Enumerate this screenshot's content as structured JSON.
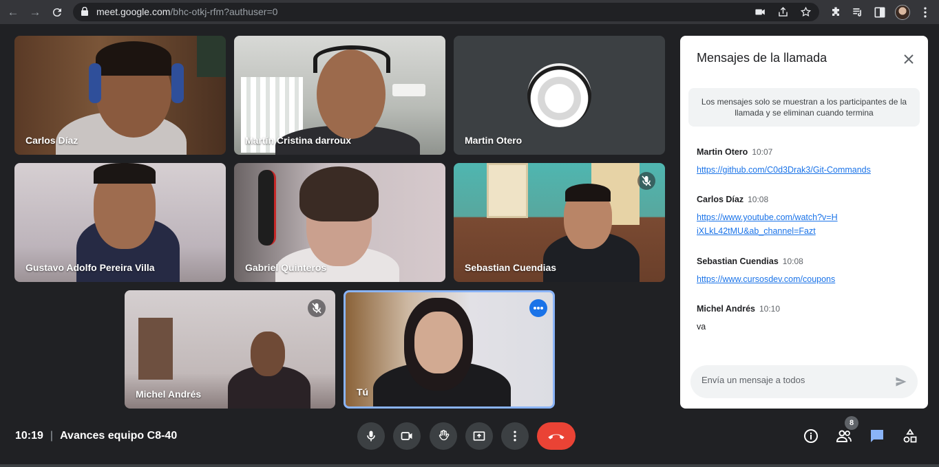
{
  "browser": {
    "url_host": "meet.google.com",
    "url_path": "/bhc-otkj-rfm?authuser=0"
  },
  "tiles": [
    {
      "name": "Carlos Díaz"
    },
    {
      "name": "Martín Cristina darroux"
    },
    {
      "name": "Martin Otero"
    },
    {
      "name": "Gustavo Adolfo Pereira Villa"
    },
    {
      "name": "Gabriel Quinteros"
    },
    {
      "name": "Sebastian Cuendias"
    },
    {
      "name": "Michel Andrés"
    },
    {
      "name": "Tú"
    }
  ],
  "chat": {
    "title": "Mensajes de la llamada",
    "notice": "Los mensajes solo se muestran a los participantes de la llamada y se eliminan cuando termina",
    "messages": [
      {
        "sender": "Martin Otero",
        "time": "10:07",
        "text": "https://github.com/C0d3Drak3/Git-Commands",
        "is_link": true
      },
      {
        "sender": "Carlos Díaz",
        "time": "10:08",
        "text": "https://www.youtube.com/watch?v=HiXLkL42tMU&ab_channel=Fazt",
        "is_link": true
      },
      {
        "sender": "Sebastian Cuendias",
        "time": "10:08",
        "text": "https://www.cursosdev.com/coupons",
        "is_link": true
      },
      {
        "sender": "Michel Andrés",
        "time": "10:10",
        "text": "va",
        "is_link": false
      }
    ],
    "input_placeholder": "Envía un mensaje a todos"
  },
  "meeting": {
    "time": "10:19",
    "separator": "|",
    "title": "Avances equipo C8-40"
  },
  "participants_count": "8",
  "colors": {
    "background": "#202124",
    "hangup": "#ea4335",
    "accent": "#1a73e8",
    "active_tile_border": "#8ab4f8",
    "chat_icon": "#8ab4f8"
  },
  "icons": [
    "back-icon",
    "forward-icon",
    "reload-icon",
    "lock-icon",
    "camera-icon",
    "share-icon",
    "star-icon",
    "puzzle-icon",
    "media-icon",
    "sidepanel-icon",
    "menu-icon",
    "mic-off-icon",
    "more-icon",
    "close-icon",
    "send-icon",
    "mic-icon",
    "video-icon",
    "hand-icon",
    "present-icon",
    "more-vert-icon",
    "hangup-icon",
    "info-icon",
    "people-icon",
    "chat-icon",
    "activities-icon"
  ]
}
